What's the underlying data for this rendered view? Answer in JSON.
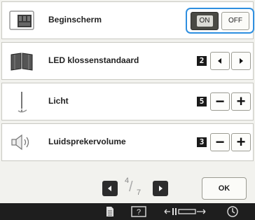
{
  "settings": {
    "rows": [
      {
        "label": "Beginscherm",
        "icon": "home-screen-icon",
        "control": "toggle",
        "on_label": "ON",
        "off_label": "OFF",
        "selected": "ON"
      },
      {
        "label": "LED klossenstandaard",
        "icon": "book-icon",
        "control": "arrows",
        "value": "2"
      },
      {
        "label": "Licht",
        "icon": "needle-light-icon",
        "control": "stepper",
        "value": "5"
      },
      {
        "label": "Luidsprekervolume",
        "icon": "speaker-icon",
        "control": "stepper",
        "value": "3"
      }
    ]
  },
  "pager": {
    "current": "4",
    "total": "7"
  },
  "footer": {
    "ok_label": "OK"
  },
  "taskbar": {
    "icons": [
      "page-icon",
      "help-icon",
      "sewing-view-icon",
      "clock-icon"
    ]
  },
  "colors": {
    "highlight": "#2e8fe0",
    "taskbar": "#1e1e1e",
    "row_bg": "#ffffff"
  }
}
